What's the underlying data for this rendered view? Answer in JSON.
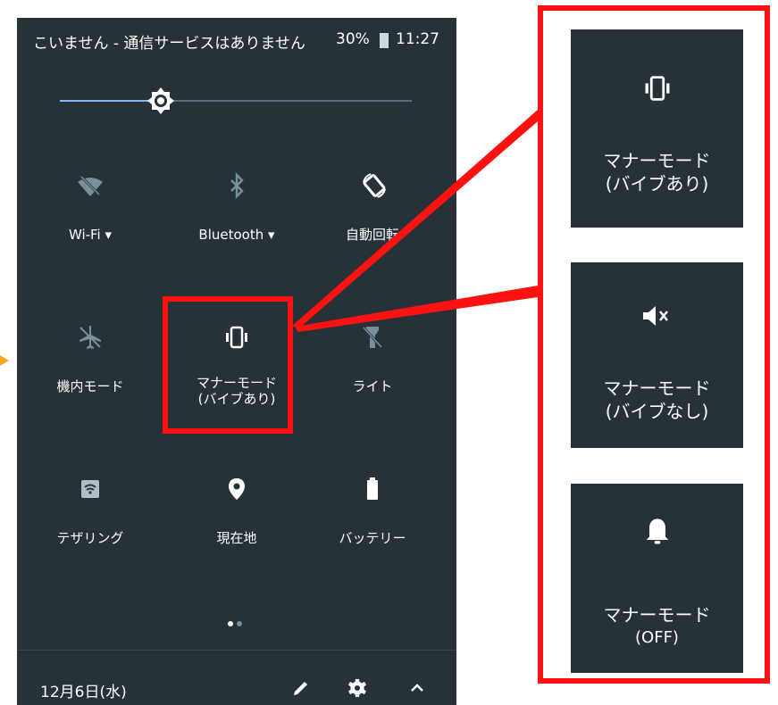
{
  "status_bar": {
    "message": "こいません - 通信サービスはありません",
    "battery_percent": "30%",
    "time": "11:27",
    "battery_icon": "battery-icon"
  },
  "brightness": {
    "level": 0.29,
    "icon": "brightness-icon"
  },
  "tiles": [
    {
      "label": "Wi-Fi",
      "icon": "wifi-off-icon",
      "dropdown": true
    },
    {
      "label": "Bluetooth",
      "icon": "bluetooth-off-icon",
      "dropdown": true
    },
    {
      "label": "自動回転",
      "icon": "auto-rotate-icon"
    },
    {
      "label": "機内モード",
      "icon": "airplane-icon"
    },
    {
      "label_line1": "マナーモード",
      "label_line2": "(バイブあり)",
      "icon": "vibrate-icon",
      "highlighted": true
    },
    {
      "label": "ライト",
      "icon": "flashlight-off-icon"
    },
    {
      "label": "テザリング",
      "icon": "hotspot-icon"
    },
    {
      "label": "現在地",
      "icon": "location-icon"
    },
    {
      "label": "バッテリー",
      "icon": "battery-full-icon"
    }
  ],
  "pager": {
    "pages": 2,
    "current": 1
  },
  "footer": {
    "date": "12月6日(水)",
    "edit_icon": "pencil-icon",
    "settings_icon": "gear-icon",
    "collapse_icon": "chevron-up-icon"
  },
  "callout_cards": [
    {
      "line1": "マナーモード",
      "line2": "(バイブあり)",
      "icon": "vibrate-icon"
    },
    {
      "line1": "マナーモード",
      "line2": "(バイブなし)",
      "icon": "mute-icon"
    },
    {
      "line1": "マナーモード",
      "line2": "(OFF)",
      "icon": "bell-icon"
    }
  ],
  "colors": {
    "panel_bg": "#263238",
    "highlight": "#ff1111",
    "accent": "#8ab4f8",
    "pointer": "#f5a623"
  }
}
